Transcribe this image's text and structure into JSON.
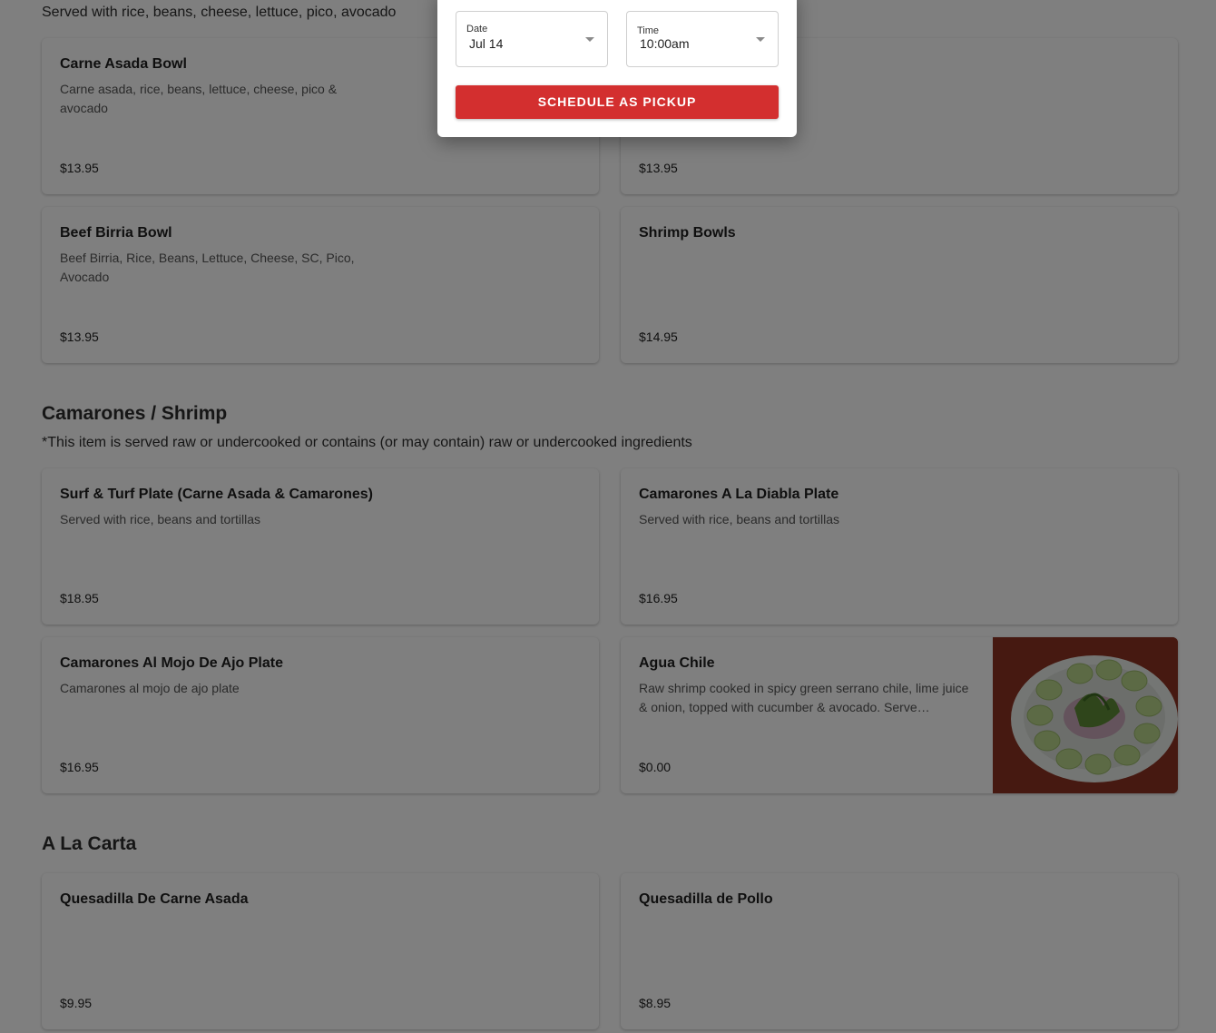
{
  "bowls": {
    "description": "Served with rice, beans, cheese, lettuce, pico, avocado",
    "items": [
      {
        "name": "Carne Asada Bowl",
        "desc": "Carne asada, rice, beans, lettuce, cheese, pico & avocado",
        "price": "$13.95"
      },
      {
        "name": "",
        "desc": "",
        "price": "$13.95"
      },
      {
        "name": "Beef Birria Bowl",
        "desc": "Beef Birria, Rice, Beans, Lettuce, Cheese, SC, Pico, Avocado",
        "price": "$13.95"
      },
      {
        "name": "Shrimp Bowls",
        "desc": "",
        "price": "$14.95"
      }
    ]
  },
  "shrimp": {
    "title": "Camarones / Shrimp",
    "description": "*This item is served raw or undercooked or contains (or may contain) raw or undercooked ingredients",
    "items": [
      {
        "name": "Surf & Turf Plate (Carne Asada & Camarones)",
        "desc": "Served with rice, beans and tortillas",
        "price": "$18.95"
      },
      {
        "name": "Camarones A La Diabla Plate",
        "desc": "Served with rice, beans and tortillas",
        "price": "$16.95"
      },
      {
        "name": "Camarones Al Mojo De Ajo Plate",
        "desc": "Camarones al mojo de ajo plate",
        "price": "$16.95"
      },
      {
        "name": "Agua Chile",
        "desc": "Raw shrimp cooked in spicy green serrano chile, lime juice & onion, topped with cucumber & avocado. Serve…",
        "price": "$0.00"
      }
    ]
  },
  "carta": {
    "title": "A La Carta",
    "items": [
      {
        "name": "Quesadilla De Carne Asada",
        "desc": "",
        "price": "$9.95"
      },
      {
        "name": "Quesadilla de Pollo",
        "desc": "",
        "price": "$8.95"
      }
    ]
  },
  "modal": {
    "date_label": "Date",
    "date_value": "Jul 14",
    "time_label": "Time",
    "time_value": "10:00am",
    "button_label": "SCHEDULE AS PICKUP"
  },
  "colors": {
    "accent": "#d32f2f"
  }
}
